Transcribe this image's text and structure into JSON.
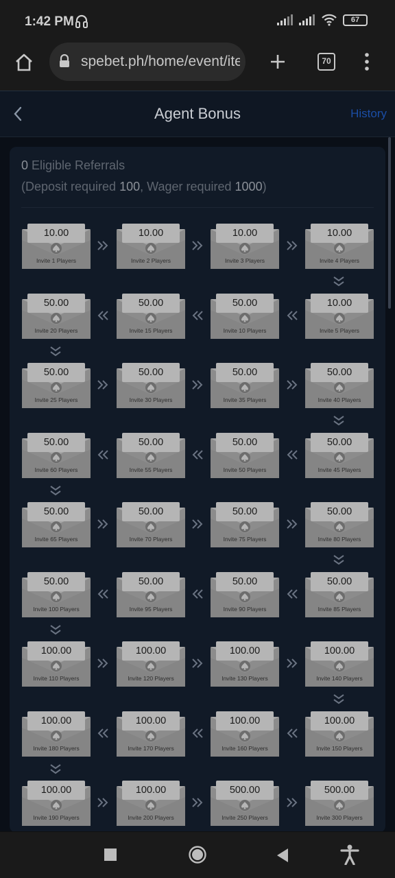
{
  "status": {
    "time": "1:42 PM",
    "battery": "67"
  },
  "browser": {
    "url": "spebet.ph/home/event/ite",
    "tab_count": "70"
  },
  "header": {
    "title": "Agent Bonus",
    "history_label": "History"
  },
  "summary": {
    "eligible_count": "0",
    "eligible_label": " Eligible Referrals",
    "req_prefix": "(Deposit required ",
    "deposit_required": "100",
    "req_middle": ", Wager required ",
    "wager_required": "1000",
    "req_suffix": ")"
  },
  "bonuses": [
    {
      "amount": "10.00",
      "label": "Invite 1 Players"
    },
    {
      "amount": "10.00",
      "label": "Invite 2 Players"
    },
    {
      "amount": "10.00",
      "label": "Invite 3 Players"
    },
    {
      "amount": "10.00",
      "label": "Invite 4 Players"
    },
    {
      "amount": "10.00",
      "label": "Invite 5 Players"
    },
    {
      "amount": "50.00",
      "label": "Invite 10 Players"
    },
    {
      "amount": "50.00",
      "label": "Invite 15 Players"
    },
    {
      "amount": "50.00",
      "label": "Invite 20 Players"
    },
    {
      "amount": "50.00",
      "label": "Invite 25 Players"
    },
    {
      "amount": "50.00",
      "label": "Invite 30 Players"
    },
    {
      "amount": "50.00",
      "label": "Invite 35 Players"
    },
    {
      "amount": "50.00",
      "label": "Invite 40 Players"
    },
    {
      "amount": "50.00",
      "label": "Invite 45 Players"
    },
    {
      "amount": "50.00",
      "label": "Invite 50 Players"
    },
    {
      "amount": "50.00",
      "label": "Invite 55 Players"
    },
    {
      "amount": "50.00",
      "label": "Invite 60 Players"
    },
    {
      "amount": "50.00",
      "label": "Invite 65 Players"
    },
    {
      "amount": "50.00",
      "label": "Invite 70 Players"
    },
    {
      "amount": "50.00",
      "label": "Invite 75 Players"
    },
    {
      "amount": "50.00",
      "label": "Invite 80 Players"
    },
    {
      "amount": "50.00",
      "label": "Invite 85 Players"
    },
    {
      "amount": "50.00",
      "label": "Invite 90 Players"
    },
    {
      "amount": "50.00",
      "label": "Invite 95 Players"
    },
    {
      "amount": "50.00",
      "label": "Invite 100 Players"
    },
    {
      "amount": "100.00",
      "label": "Invite 110 Players"
    },
    {
      "amount": "100.00",
      "label": "Invite 120 Players"
    },
    {
      "amount": "100.00",
      "label": "Invite 130 Players"
    },
    {
      "amount": "100.00",
      "label": "Invite 140 Players"
    },
    {
      "amount": "100.00",
      "label": "Invite 150 Players"
    },
    {
      "amount": "100.00",
      "label": "Invite 160 Players"
    },
    {
      "amount": "100.00",
      "label": "Invite 170 Players"
    },
    {
      "amount": "100.00",
      "label": "Invite 180 Players"
    },
    {
      "amount": "100.00",
      "label": "Invite 190 Players"
    },
    {
      "amount": "100.00",
      "label": "Invite 200 Players"
    },
    {
      "amount": "500.00",
      "label": "Invite 250 Players"
    },
    {
      "amount": "500.00",
      "label": "Invite 300 Players"
    }
  ]
}
